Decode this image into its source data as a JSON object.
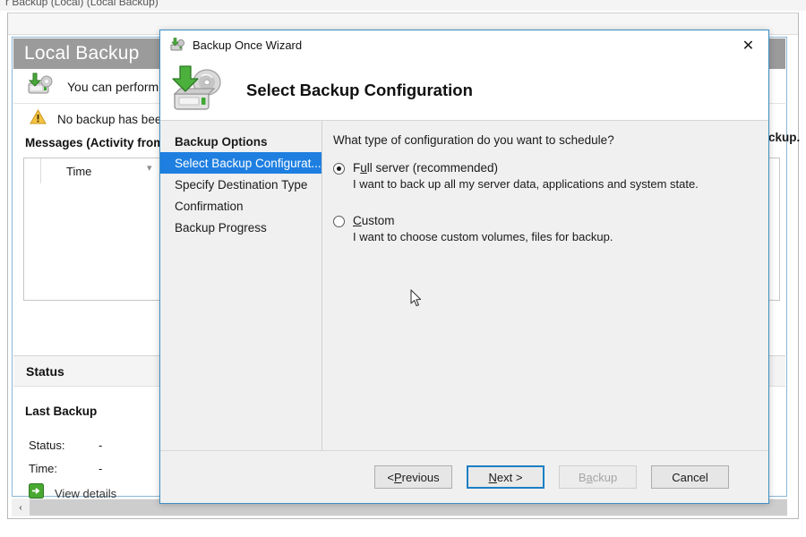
{
  "background_window": {
    "titlebar_text": "r Backup (Local) (Local Backup)",
    "local_backup_header": "Local Backup",
    "intro_text": "You can perform",
    "warning_text": "No backup has been",
    "messages_label": "Messages (Activity from last",
    "messages_column_time": "Time",
    "status_section_title": "Status",
    "last_backup_title": "Last Backup",
    "status_label": "Status:",
    "status_value": "-",
    "time_label": "Time:",
    "time_value": "-",
    "view_details_text": "View details",
    "right_fragment_text": "ckup.",
    "scroll_left_arrow": "‹"
  },
  "wizard": {
    "titlebar": {
      "title": "Backup Once Wizard",
      "icon": "backup-wizard-icon",
      "close_label": "✕"
    },
    "banner": {
      "icon": "backup-disk-icon",
      "heading": "Select Backup Configuration"
    },
    "nav_items": [
      {
        "label": "Backup Options",
        "selected": false,
        "bold": true
      },
      {
        "label": "Select Backup Configurat...",
        "selected": true,
        "bold": false
      },
      {
        "label": "Specify Destination Type",
        "selected": false,
        "bold": false
      },
      {
        "label": "Confirmation",
        "selected": false,
        "bold": false
      },
      {
        "label": "Backup Progress",
        "selected": false,
        "bold": false
      }
    ],
    "main": {
      "question": "What type of configuration do you want to schedule?",
      "options": [
        {
          "label_before": "F",
          "label_accel": "u",
          "label_after": "ll server (recommended)",
          "label_plain": "Full server (recommended)",
          "description": "I want to back up all my server data, applications and system state.",
          "checked": true
        },
        {
          "label_before": "",
          "label_accel": "C",
          "label_after": "ustom",
          "label_plain": "Custom",
          "description": "I want to choose custom volumes, files for backup.",
          "checked": false
        }
      ]
    },
    "footer": {
      "previous": {
        "before": "< ",
        "accel": "P",
        "after": "revious",
        "plain": "< Previous",
        "disabled": false,
        "focused": false
      },
      "next": {
        "before": "",
        "accel": "N",
        "after": "ext >",
        "plain": "Next >",
        "disabled": false,
        "focused": true
      },
      "backup": {
        "before": "B",
        "accel": "a",
        "after": "ckup",
        "plain": "Backup",
        "disabled": true,
        "focused": false
      },
      "cancel": {
        "before": "",
        "accel": "",
        "after": "Cancel",
        "plain": "Cancel",
        "disabled": false,
        "focused": false
      }
    }
  },
  "colors": {
    "selection_blue": "#1e7fe0",
    "dialog_border_blue": "#3d8fc4",
    "focus_border_blue": "#1a7fc4",
    "header_gray": "#9b9b9b",
    "dialog_bg": "#f0f0f0",
    "warning_yellow": "#f5c242",
    "accent_green": "#3ea832"
  }
}
